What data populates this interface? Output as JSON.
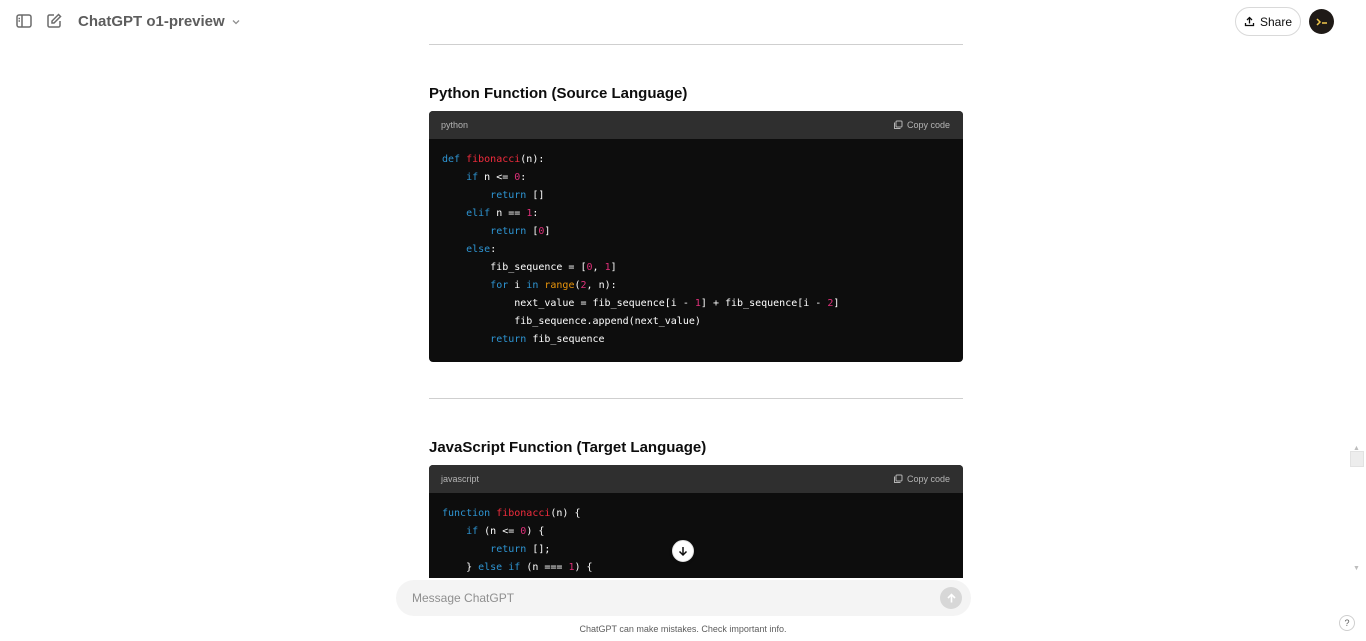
{
  "header": {
    "model_name": "ChatGPT o1-preview",
    "share_label": "Share"
  },
  "sections": [
    {
      "heading": "Python Function (Source Language)",
      "language": "python",
      "copy_label": "Copy code"
    },
    {
      "heading": "JavaScript Function (Target Language)",
      "language": "javascript",
      "copy_label": "Copy code"
    }
  ],
  "python_code": [
    [
      [
        "def ",
        "kw"
      ],
      [
        "fibonacci",
        "fn"
      ],
      [
        "(n):",
        ""
      ]
    ],
    [
      [
        "    ",
        ""
      ],
      [
        "if",
        "kw"
      ],
      [
        " n <= ",
        ""
      ],
      [
        "0",
        "num"
      ],
      [
        ":",
        ""
      ]
    ],
    [
      [
        "        ",
        ""
      ],
      [
        "return",
        "kw"
      ],
      [
        " []",
        ""
      ]
    ],
    [
      [
        "    ",
        ""
      ],
      [
        "elif",
        "kw"
      ],
      [
        " n == ",
        ""
      ],
      [
        "1",
        "num"
      ],
      [
        ":",
        ""
      ]
    ],
    [
      [
        "        ",
        ""
      ],
      [
        "return",
        "kw"
      ],
      [
        " [",
        ""
      ],
      [
        "0",
        "num"
      ],
      [
        "]",
        ""
      ]
    ],
    [
      [
        "    ",
        ""
      ],
      [
        "else",
        "kw"
      ],
      [
        ":",
        ""
      ]
    ],
    [
      [
        "        fib_sequence = [",
        ""
      ],
      [
        "0",
        "num"
      ],
      [
        ", ",
        ""
      ],
      [
        "1",
        "num"
      ],
      [
        "]",
        ""
      ]
    ],
    [
      [
        "        ",
        ""
      ],
      [
        "for",
        "kw"
      ],
      [
        " i ",
        ""
      ],
      [
        "in",
        "kw"
      ],
      [
        " ",
        ""
      ],
      [
        "range",
        "bi"
      ],
      [
        "(",
        ""
      ],
      [
        "2",
        "num"
      ],
      [
        ", n):",
        ""
      ]
    ],
    [
      [
        "            next_value = fib_sequence[i - ",
        ""
      ],
      [
        "1",
        "num"
      ],
      [
        "] + fib_sequence[i - ",
        ""
      ],
      [
        "2",
        "num"
      ],
      [
        "]",
        ""
      ]
    ],
    [
      [
        "            fib_sequence.append(next_value)",
        ""
      ]
    ],
    [
      [
        "        ",
        ""
      ],
      [
        "return",
        "kw"
      ],
      [
        " fib_sequence",
        ""
      ]
    ]
  ],
  "javascript_code": [
    [
      [
        "function",
        "kw"
      ],
      [
        " ",
        ""
      ],
      [
        "fibonacci",
        "fn"
      ],
      [
        "(n) {",
        ""
      ]
    ],
    [
      [
        "    ",
        ""
      ],
      [
        "if",
        "kw"
      ],
      [
        " (n <= ",
        ""
      ],
      [
        "0",
        "num"
      ],
      [
        ") {",
        ""
      ]
    ],
    [
      [
        "        ",
        ""
      ],
      [
        "return",
        "kw"
      ],
      [
        " [];",
        ""
      ]
    ],
    [
      [
        "    } ",
        ""
      ],
      [
        "else",
        "kw"
      ],
      [
        " ",
        ""
      ],
      [
        "if",
        "kw"
      ],
      [
        " (n === ",
        ""
      ],
      [
        "1",
        "num"
      ],
      [
        ") {",
        ""
      ]
    ]
  ],
  "composer": {
    "placeholder": "Message ChatGPT"
  },
  "footer": {
    "disclaimer": "ChatGPT can make mistakes. Check important info.",
    "help_label": "?"
  },
  "colors": {
    "keyword": "#2e95d3",
    "function_name": "#f22c3d",
    "number": "#df3079",
    "builtin": "#e9950c",
    "code_background": "#0d0d0d",
    "code_header": "#2f2f2f"
  }
}
